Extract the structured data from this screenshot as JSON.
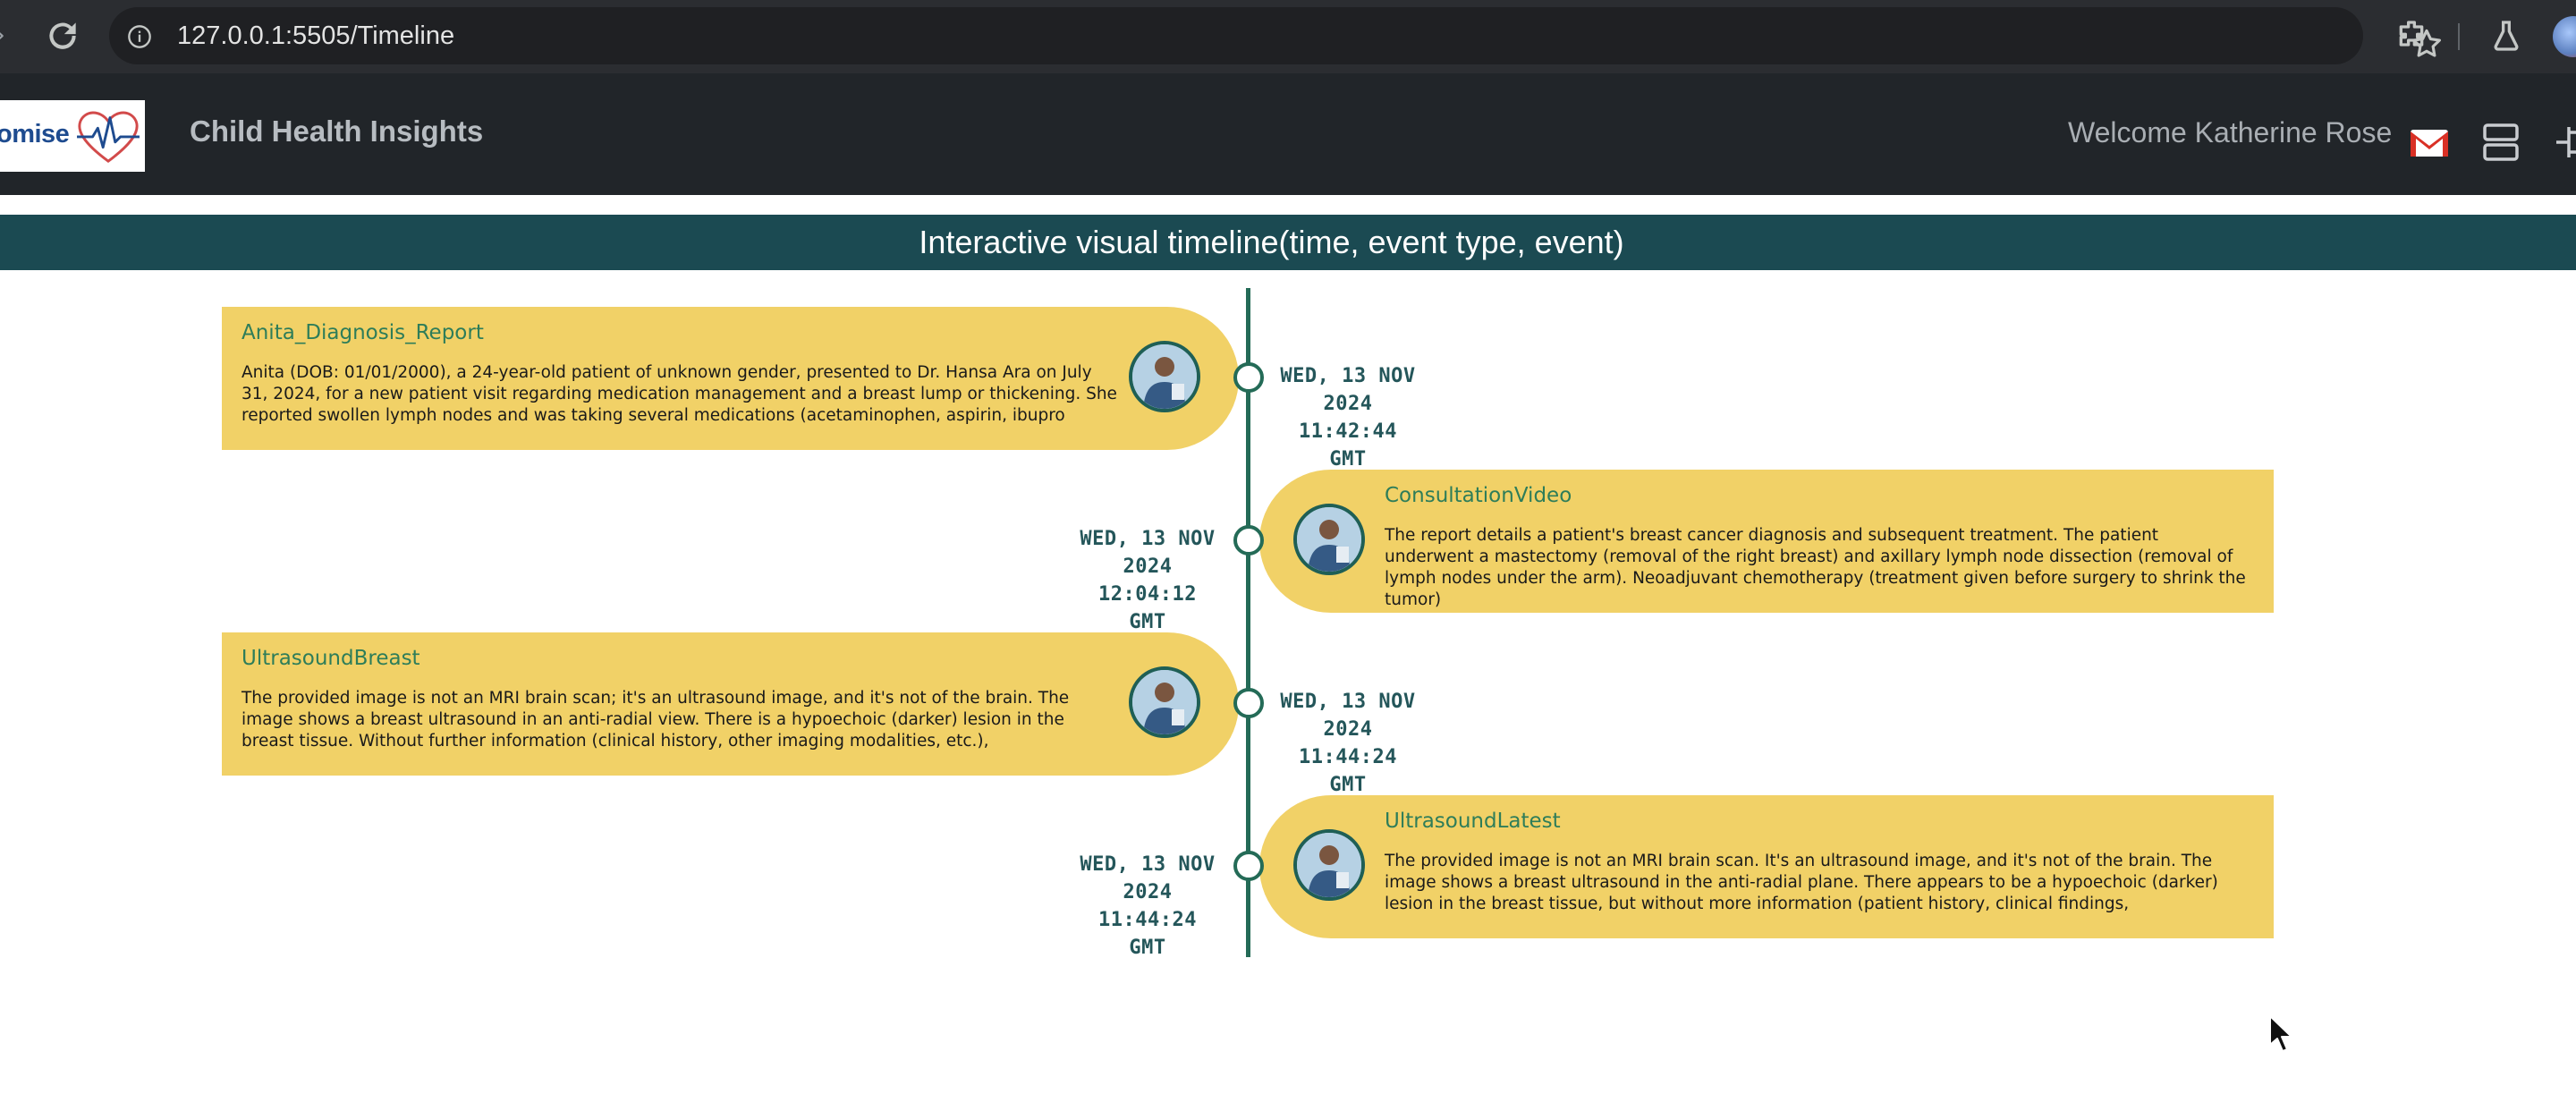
{
  "browser": {
    "url": "127.0.0.1:5505/Timeline"
  },
  "header": {
    "logo_text": "omise",
    "brand": "Child Health Insights",
    "welcome": "Welcome Katherine Rose",
    "icons": [
      "mail-icon",
      "list-icon"
    ]
  },
  "timeline": {
    "title": "Interactive visual timeline(time, event type, event)",
    "events": [
      {
        "side": "left",
        "title": "Anita_Diagnosis_Report",
        "text": "Anita (DOB: 01/01/2000), a 24-year-old patient of unknown gender, presented to Dr. Hansa Ara on July 31, 2024, for a new patient visit regarding medication management and a breast lump or thickening. She reported swollen lymph nodes and was taking several medications (acetaminophen, aspirin, ibupro",
        "date_line1": "WED, 13 NOV",
        "date_line2": "2024 11:42:44",
        "date_line3": "GMT"
      },
      {
        "side": "right",
        "title": "ConsultationVideo",
        "text": "The report details a patient's breast cancer diagnosis and subsequent treatment. The patient underwent a mastectomy (removal of the right breast) and axillary lymph node dissection (removal of lymph nodes under the arm). Neoadjuvant chemotherapy (treatment given before surgery to shrink the tumor)",
        "date_line1": "WED, 13 NOV",
        "date_line2": "2024 12:04:12",
        "date_line3": "GMT"
      },
      {
        "side": "left",
        "title": "UltrasoundBreast",
        "text": "The provided image is not an MRI brain scan; it's an ultrasound image, and it's not of the brain. The image shows a breast ultrasound in an anti-radial view. There is a hypoechoic (darker) lesion in the breast tissue. Without further information (clinical history, other imaging modalities, etc.),",
        "date_line1": "WED, 13 NOV",
        "date_line2": "2024 11:44:24",
        "date_line3": "GMT"
      },
      {
        "side": "right",
        "title": "UltrasoundLatest",
        "text": "The provided image is not an MRI brain scan. It's an ultrasound image, and it's not of the brain. The image shows a breast ultrasound in the anti-radial plane. There appears to be a hypoechoic (darker) lesion in the breast tissue, but without more information (patient history, clinical findings,",
        "date_line1": "WED, 13 NOV",
        "date_line2": "2024 11:44:24",
        "date_line3": "GMT"
      }
    ]
  },
  "colors": {
    "card": "#f1d167",
    "accent": "#246b57",
    "title_bar": "#1b4a52",
    "header": "#212529"
  }
}
